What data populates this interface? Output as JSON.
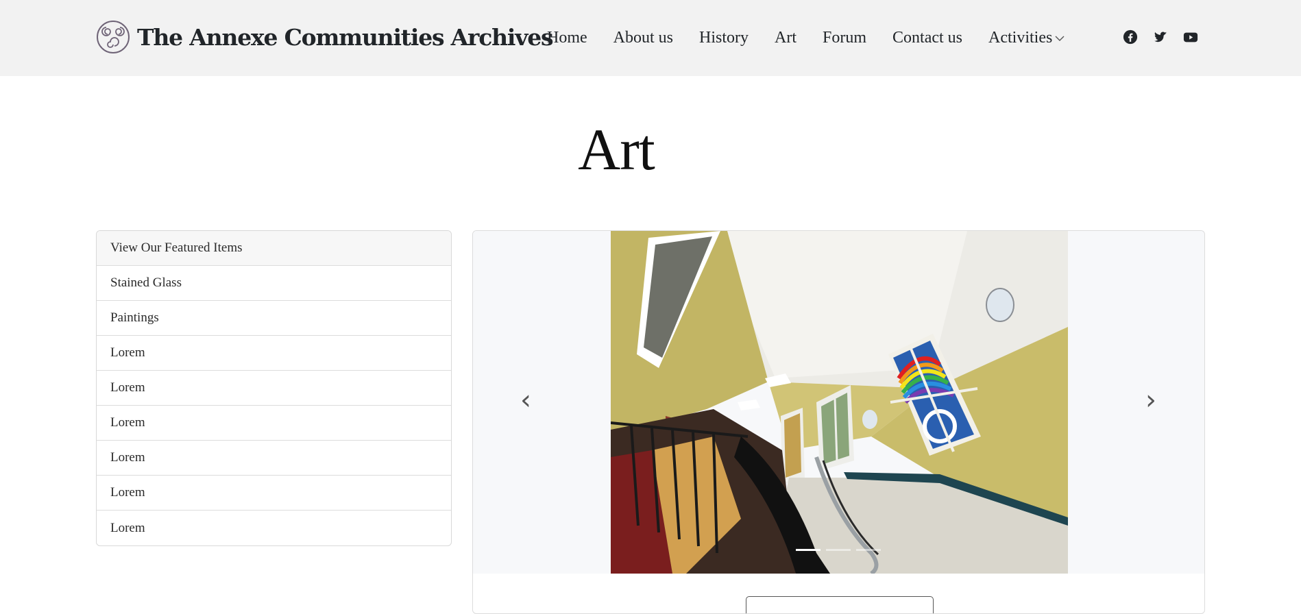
{
  "header": {
    "brand_name": "The Annexe Communities Archives",
    "logo_icon": "triple-spiral-logo",
    "nav": [
      {
        "label": "Home"
      },
      {
        "label": "About us"
      },
      {
        "label": "History"
      },
      {
        "label": "Art"
      },
      {
        "label": "Forum"
      },
      {
        "label": "Contact us"
      },
      {
        "label": "Activities"
      }
    ],
    "social": [
      "facebook-icon",
      "twitter-icon",
      "youtube-icon"
    ]
  },
  "page": {
    "title": "Art"
  },
  "sidebar": {
    "items": [
      {
        "label": "View Our Featured Items",
        "active": true
      },
      {
        "label": "Stained Glass"
      },
      {
        "label": "Paintings"
      },
      {
        "label": "Lorem"
      },
      {
        "label": "Lorem"
      },
      {
        "label": "Lorem"
      },
      {
        "label": "Lorem"
      },
      {
        "label": "Lorem"
      },
      {
        "label": "Lorem"
      }
    ]
  },
  "carousel": {
    "prev_icon": "chevron-left-icon",
    "next_icon": "chevron-right-icon",
    "prev_glyph": "‹",
    "next_glyph": "›",
    "slide_count": 3,
    "active_slide": 1
  },
  "colors": {
    "header_bg": "#f2f2f2",
    "carousel_bg": "#f7f8fa",
    "wall_yellow": "#c9bc6a",
    "ceiling": "#ecebe6",
    "tile": "#d9d6cc"
  }
}
